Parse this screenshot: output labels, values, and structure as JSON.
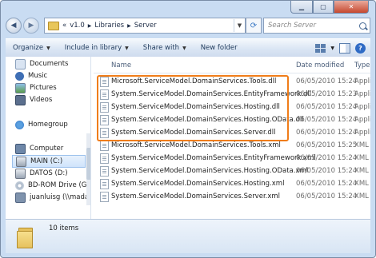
{
  "address": {
    "crumbs": [
      "«",
      "v1.0",
      "▶",
      "Libraries",
      "▶",
      "Server"
    ],
    "search_placeholder": "Search Server"
  },
  "toolbar": {
    "organize": "Organize",
    "include": "Include in library",
    "share": "Share with",
    "new_folder": "New folder"
  },
  "nav": {
    "items": [
      "Documents",
      "Music",
      "Pictures",
      "Videos",
      "Homegroup",
      "Computer",
      "MAIN (C:)",
      "DATOS (D:)",
      "BD-ROM Drive (G",
      "juanluisg (\\\\mada"
    ]
  },
  "columns": {
    "name": "Name",
    "date": "Date modified",
    "type": "Type"
  },
  "files": [
    {
      "name": "Microsoft.ServiceModel.DomainServices.Tools.dll",
      "date": "06/05/2010 15:24",
      "type": "Applic"
    },
    {
      "name": "System.ServiceModel.DomainServices.EntityFramework.dll",
      "date": "06/05/2010 15:23",
      "type": "Applic"
    },
    {
      "name": "System.ServiceModel.DomainServices.Hosting.dll",
      "date": "06/05/2010 15:24",
      "type": "Applic"
    },
    {
      "name": "System.ServiceModel.DomainServices.Hosting.OData.dll",
      "date": "06/05/2010 15:24",
      "type": "Applic"
    },
    {
      "name": "System.ServiceModel.DomainServices.Server.dll",
      "date": "06/05/2010 15:24",
      "type": "Applic"
    },
    {
      "name": "Microsoft.ServiceModel.DomainServices.Tools.xml",
      "date": "06/05/2010 15:25",
      "type": "XML"
    },
    {
      "name": "System.ServiceModel.DomainServices.EntityFramework.xml",
      "date": "06/05/2010 15:24",
      "type": "XML"
    },
    {
      "name": "System.ServiceModel.DomainServices.Hosting.OData.xml",
      "date": "06/05/2010 15:24",
      "type": "XML"
    },
    {
      "name": "System.ServiceModel.DomainServices.Hosting.xml",
      "date": "06/05/2010 15:24",
      "type": "XML"
    },
    {
      "name": "System.ServiceModel.DomainServices.Server.xml",
      "date": "06/05/2010 15:24",
      "type": "XML"
    }
  ],
  "status": {
    "items": "10 items"
  },
  "colors": {
    "highlight": "#f07d1a",
    "toolbar": "#dbe6f4"
  }
}
